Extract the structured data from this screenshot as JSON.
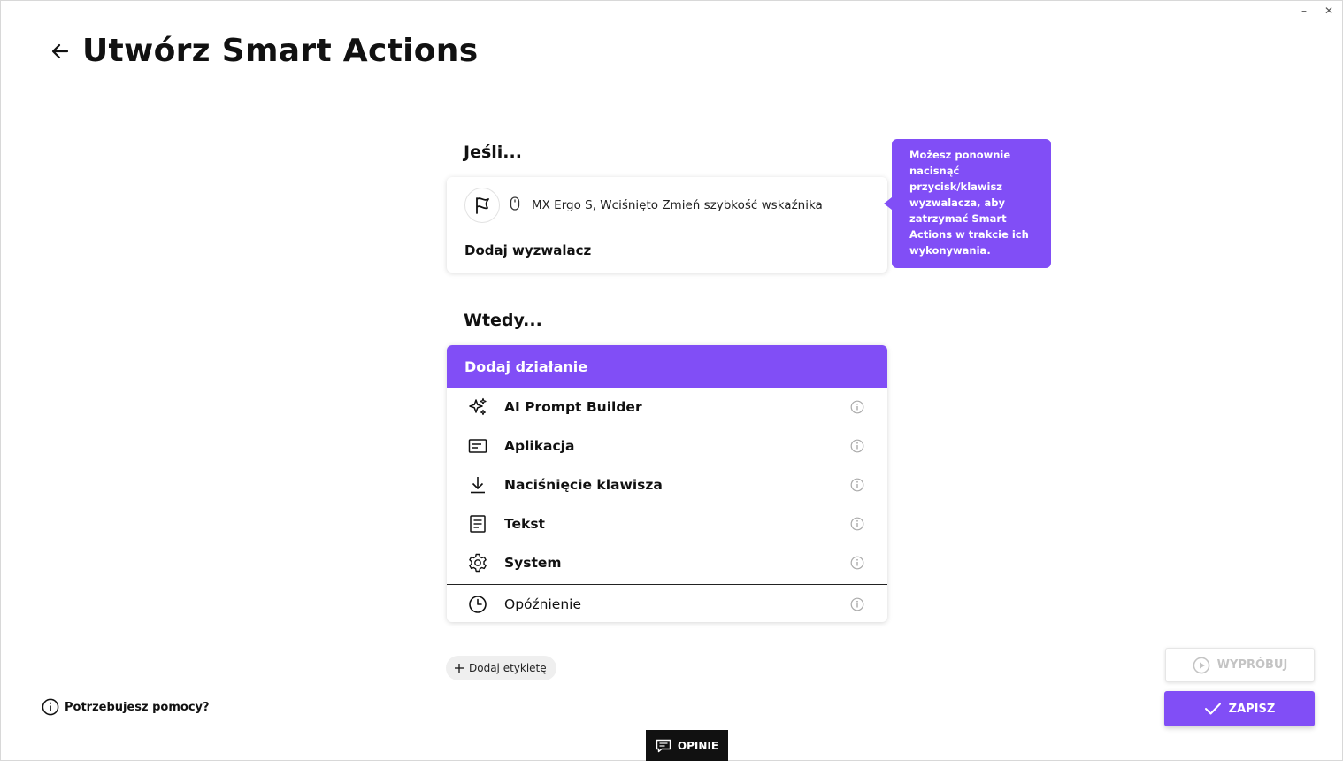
{
  "window": {
    "minimize_glyph": "–",
    "close_glyph": "✕"
  },
  "header": {
    "title": "Utwórz Smart Actions",
    "back_icon": "arrow-left-icon"
  },
  "if_section": {
    "label": "Jeśli...",
    "trigger": {
      "icon": "flag-icon",
      "device_icon": "mouse-icon",
      "text": "MX Ergo S, Wciśnięto Zmień szybkość wskaźnika"
    },
    "add_trigger_label": "Dodaj wyzwalacz"
  },
  "tooltip": {
    "text": "Możesz ponownie nacisnąć przycisk/klawisz wyzwalacza, aby zatrzymać Smart Actions w trakcie ich wykonywania."
  },
  "then_section": {
    "label": "Wtedy...",
    "add_action_label": "Dodaj działanie",
    "actions": [
      {
        "label": "AI Prompt Builder",
        "icon": "sparkles-icon"
      },
      {
        "label": "Aplikacja",
        "icon": "app-window-icon"
      },
      {
        "label": "Naciśnięcie klawisza",
        "icon": "download-arrow-icon"
      },
      {
        "label": "Tekst",
        "icon": "document-icon"
      },
      {
        "label": "System",
        "icon": "gear-icon"
      }
    ],
    "delay": {
      "label": "Opóźnienie",
      "icon": "clock-icon"
    }
  },
  "add_label_button": {
    "label": "Dodaj etykietę"
  },
  "help": {
    "label": "Potrzebujesz pomocy?"
  },
  "buttons": {
    "try_label": "WYPRÓBUJ",
    "save_label": "ZAPISZ"
  },
  "feedback": {
    "label": "OPINIE"
  },
  "colors": {
    "accent": "#814ef6",
    "feedback_bg": "#111111",
    "disabled_text": "#c4c4c4"
  }
}
